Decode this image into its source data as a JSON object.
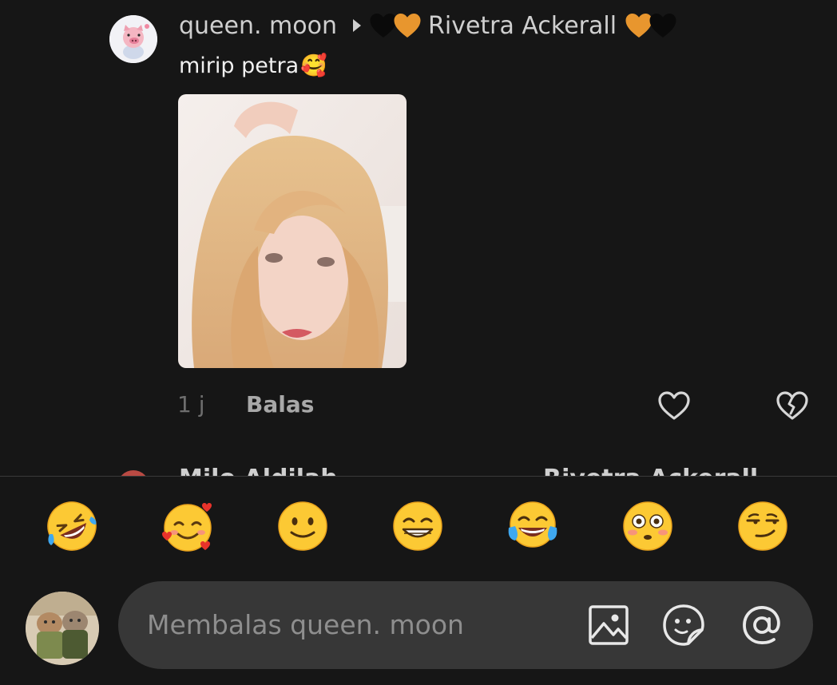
{
  "comment": {
    "username": "queen. moon",
    "reply_to": "Rivetra Ackerall",
    "text": "mirip petra",
    "text_emoji": "🥰",
    "timestamp": "1 j",
    "reply_label": "Balas"
  },
  "next_comment": {
    "username": "Milo Aldilah",
    "reply_to": "Rivetra Ackerall"
  },
  "emoji_bar": [
    "🤣",
    "🥰",
    "🙂",
    "😁",
    "😂",
    "😳",
    "😏"
  ],
  "reply_input": {
    "placeholder": "Membalas queen. moon"
  },
  "colors": {
    "background": "#161616",
    "input_field": "#373737",
    "heart_orange": "#e8962e",
    "heart_black": "#0a0a0a"
  },
  "icons": {
    "like": "heart-outline-icon",
    "dislike": "broken-heart-icon",
    "image": "image-icon",
    "sticker": "sticker-icon",
    "mention": "at-sign-icon"
  }
}
